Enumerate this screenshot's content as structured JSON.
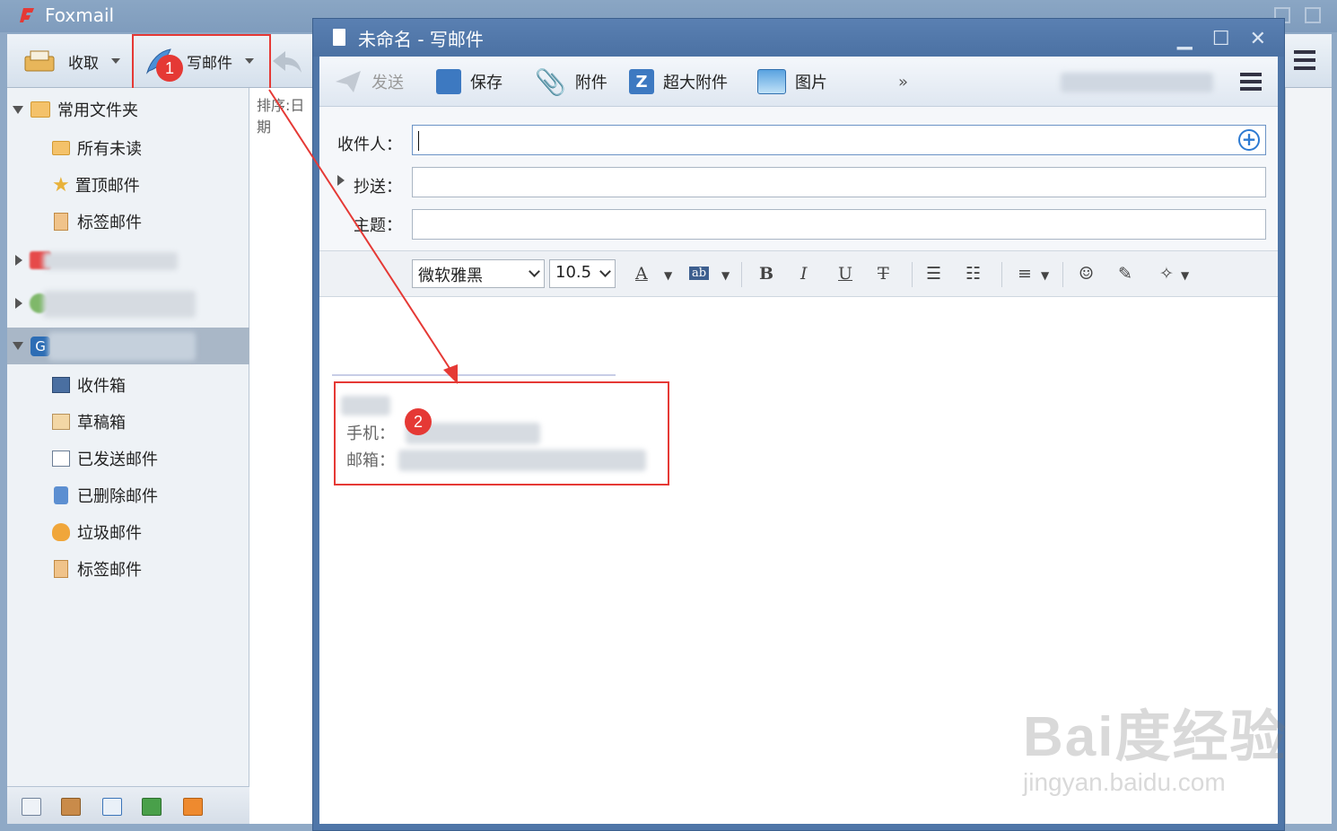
{
  "app": {
    "title": "Foxmail"
  },
  "main_toolbar": {
    "receive_label": "收取",
    "compose_label": "写邮件"
  },
  "sidebar": {
    "common_folder": "常用文件夹",
    "common_items": [
      "所有未读",
      "置顶邮件",
      "标签邮件"
    ],
    "account_folders": [
      "收件箱",
      "草稿箱",
      "已发送邮件",
      "已删除邮件",
      "垃圾邮件",
      "标签邮件"
    ]
  },
  "list_pane": {
    "sort_label": "排序:日期"
  },
  "compose": {
    "window_title": "未命名 - 写邮件",
    "toolbar": {
      "send": "发送",
      "save": "保存",
      "attach": "附件",
      "big_attach": "超大附件",
      "picture": "图片",
      "more": "»"
    },
    "fields": {
      "to_label": "收件人：",
      "cc_label": "抄送：",
      "subject_label": "主题："
    },
    "format": {
      "font_name": "微软雅黑",
      "font_size": "10.5"
    },
    "signature": {
      "phone_label": "手机：",
      "email_label": "邮箱："
    }
  },
  "annotations": {
    "step1": "1",
    "step2": "2",
    "color": "#e53935"
  },
  "watermark": {
    "line1": "Bai度经验",
    "line2": "jingyan.baidu.com"
  }
}
